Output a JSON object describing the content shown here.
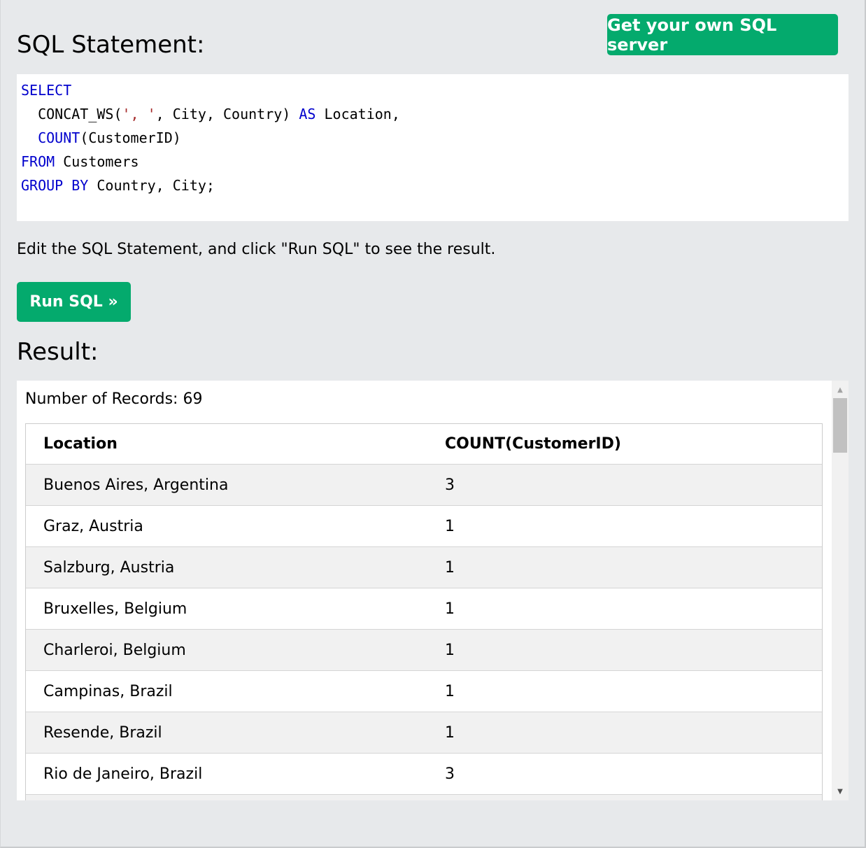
{
  "header": {
    "title": "SQL Statement:",
    "server_button": "Get your own SQL server"
  },
  "code": {
    "line1_kw": "SELECT",
    "line2_fn": "  CONCAT_WS(",
    "line2_str1": "', '",
    "line2_rest": ", City, Country) ",
    "line2_kw": "AS",
    "line2_tail": " Location,",
    "line3_indent": "  ",
    "line3_kw": "COUNT",
    "line3_rest": "(CustomerID)",
    "line4_kw": "FROM",
    "line4_rest": " Customers",
    "line5_kw": "GROUP BY",
    "line5_rest": " Country, City;"
  },
  "hint": "Edit the SQL Statement, and click \"Run SQL\" to see the result.",
  "run_button": "Run SQL »",
  "result": {
    "title": "Result:",
    "records_label": "Number of Records: 69",
    "columns": [
      "Location",
      "COUNT(CustomerID)"
    ],
    "rows": [
      {
        "location": "Buenos Aires, Argentina",
        "count": "3"
      },
      {
        "location": "Graz, Austria",
        "count": "1"
      },
      {
        "location": "Salzburg, Austria",
        "count": "1"
      },
      {
        "location": "Bruxelles, Belgium",
        "count": "1"
      },
      {
        "location": "Charleroi, Belgium",
        "count": "1"
      },
      {
        "location": "Campinas, Brazil",
        "count": "1"
      },
      {
        "location": "Resende, Brazil",
        "count": "1"
      },
      {
        "location": "Rio de Janeiro, Brazil",
        "count": "3"
      }
    ]
  },
  "icons": {
    "scroll_up": "▲",
    "scroll_down": "▼"
  },
  "colors": {
    "accent": "#04aa6d",
    "keyword": "#0000cd",
    "string": "#a52a2a"
  }
}
